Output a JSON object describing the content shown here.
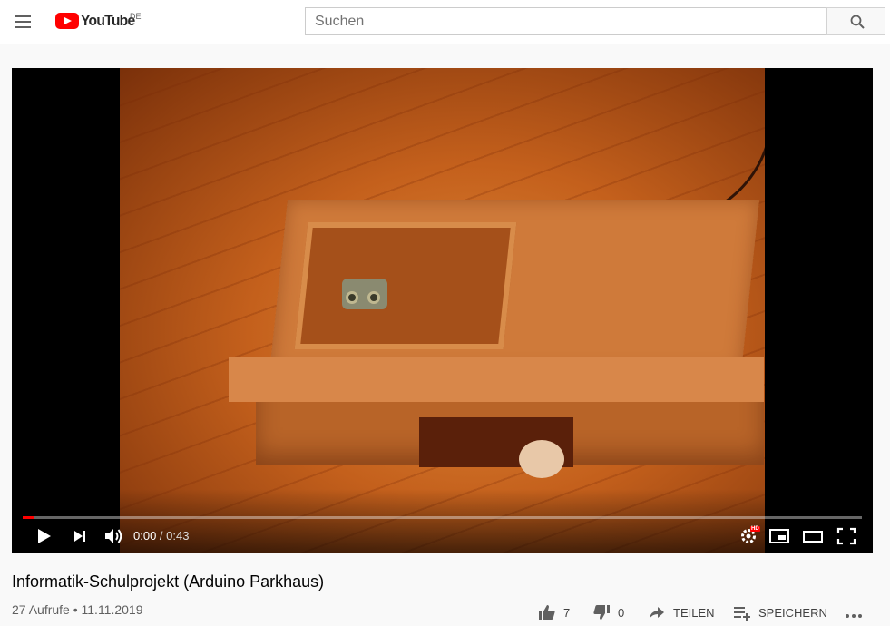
{
  "masthead": {
    "logo_text": "YouTube",
    "country_code": "DE",
    "search_placeholder": "Suchen"
  },
  "player": {
    "current_time": "0:00",
    "separator": " / ",
    "duration": "0:43",
    "progress_fraction": 0.013,
    "hd_badge": "HD",
    "accent_color": "#ff0000"
  },
  "video": {
    "title": "Informatik-Schulprojekt (Arduino Parkhaus)",
    "views": "27 Aufrufe",
    "dot": " • ",
    "date": "11.11.2019"
  },
  "actions": {
    "likes": "7",
    "dislikes": "0",
    "share_label": "TEILEN",
    "save_label": "SPEICHERN"
  },
  "icons": [
    "menu-icon",
    "youtube-logo",
    "search-icon",
    "play-icon",
    "next-icon",
    "volume-icon",
    "settings-icon",
    "miniplayer-icon",
    "theater-mode-icon",
    "fullscreen-icon",
    "like-icon",
    "dislike-icon",
    "share-icon",
    "save-playlist-icon",
    "more-icon"
  ]
}
